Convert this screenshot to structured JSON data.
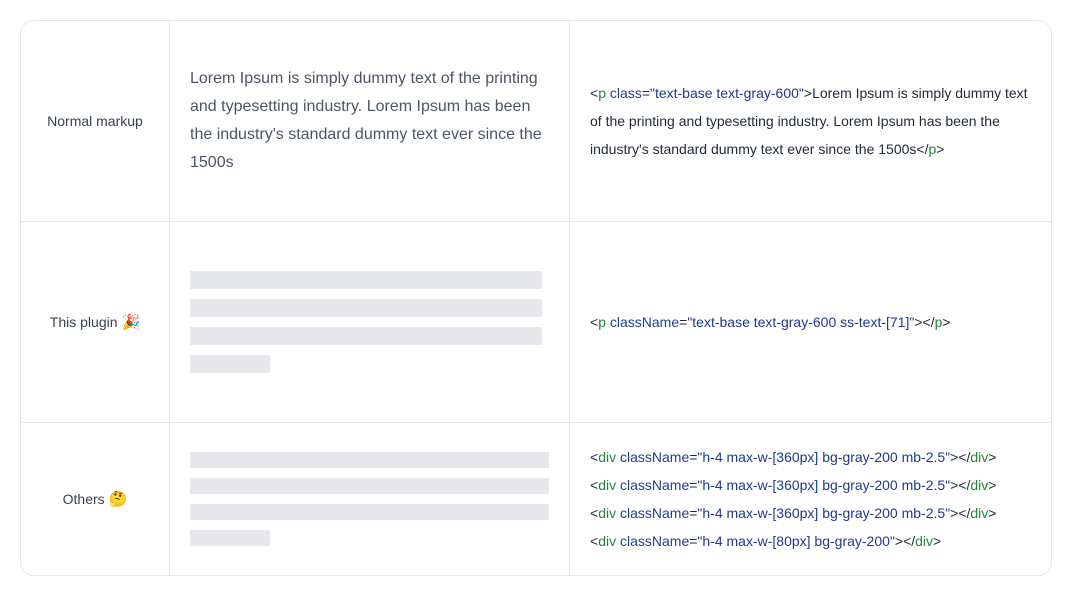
{
  "rows": [
    {
      "label": "Normal markup",
      "emoji": "",
      "demo_text": "Lorem Ipsum is simply dummy text of the printing and typesetting industry. Lorem Ipsum has been the industry's standard dummy text ever since the 1500s",
      "code": {
        "open_tag": "p",
        "attr": "class",
        "value": "\"text-base text-gray-600\"",
        "content": "Lorem Ipsum is simply dummy text of the printing and typesetting industry. Lorem Ipsum has been the industry's standard dummy text ever since the 1500s",
        "close_tag": "p"
      }
    },
    {
      "label": "This plugin",
      "emoji": "🎉",
      "code": {
        "open_tag": "p",
        "attr": "className",
        "value": "\"text-base text-gray-600 ss-text-[71]\"",
        "close_tag": "p"
      }
    },
    {
      "label": "Others",
      "emoji": "🤔",
      "code_lines": [
        {
          "tag": "div",
          "attr": "className",
          "value": "\"h-4 max-w-[360px] bg-gray-200 mb-2.5\""
        },
        {
          "tag": "div",
          "attr": "className",
          "value": "\"h-4 max-w-[360px] bg-gray-200 mb-2.5\""
        },
        {
          "tag": "div",
          "attr": "className",
          "value": "\"h-4 max-w-[360px] bg-gray-200 mb-2.5\""
        },
        {
          "tag": "div",
          "attr": "className",
          "value": "\"h-4 max-w-[80px] bg-gray-200\""
        }
      ]
    }
  ]
}
